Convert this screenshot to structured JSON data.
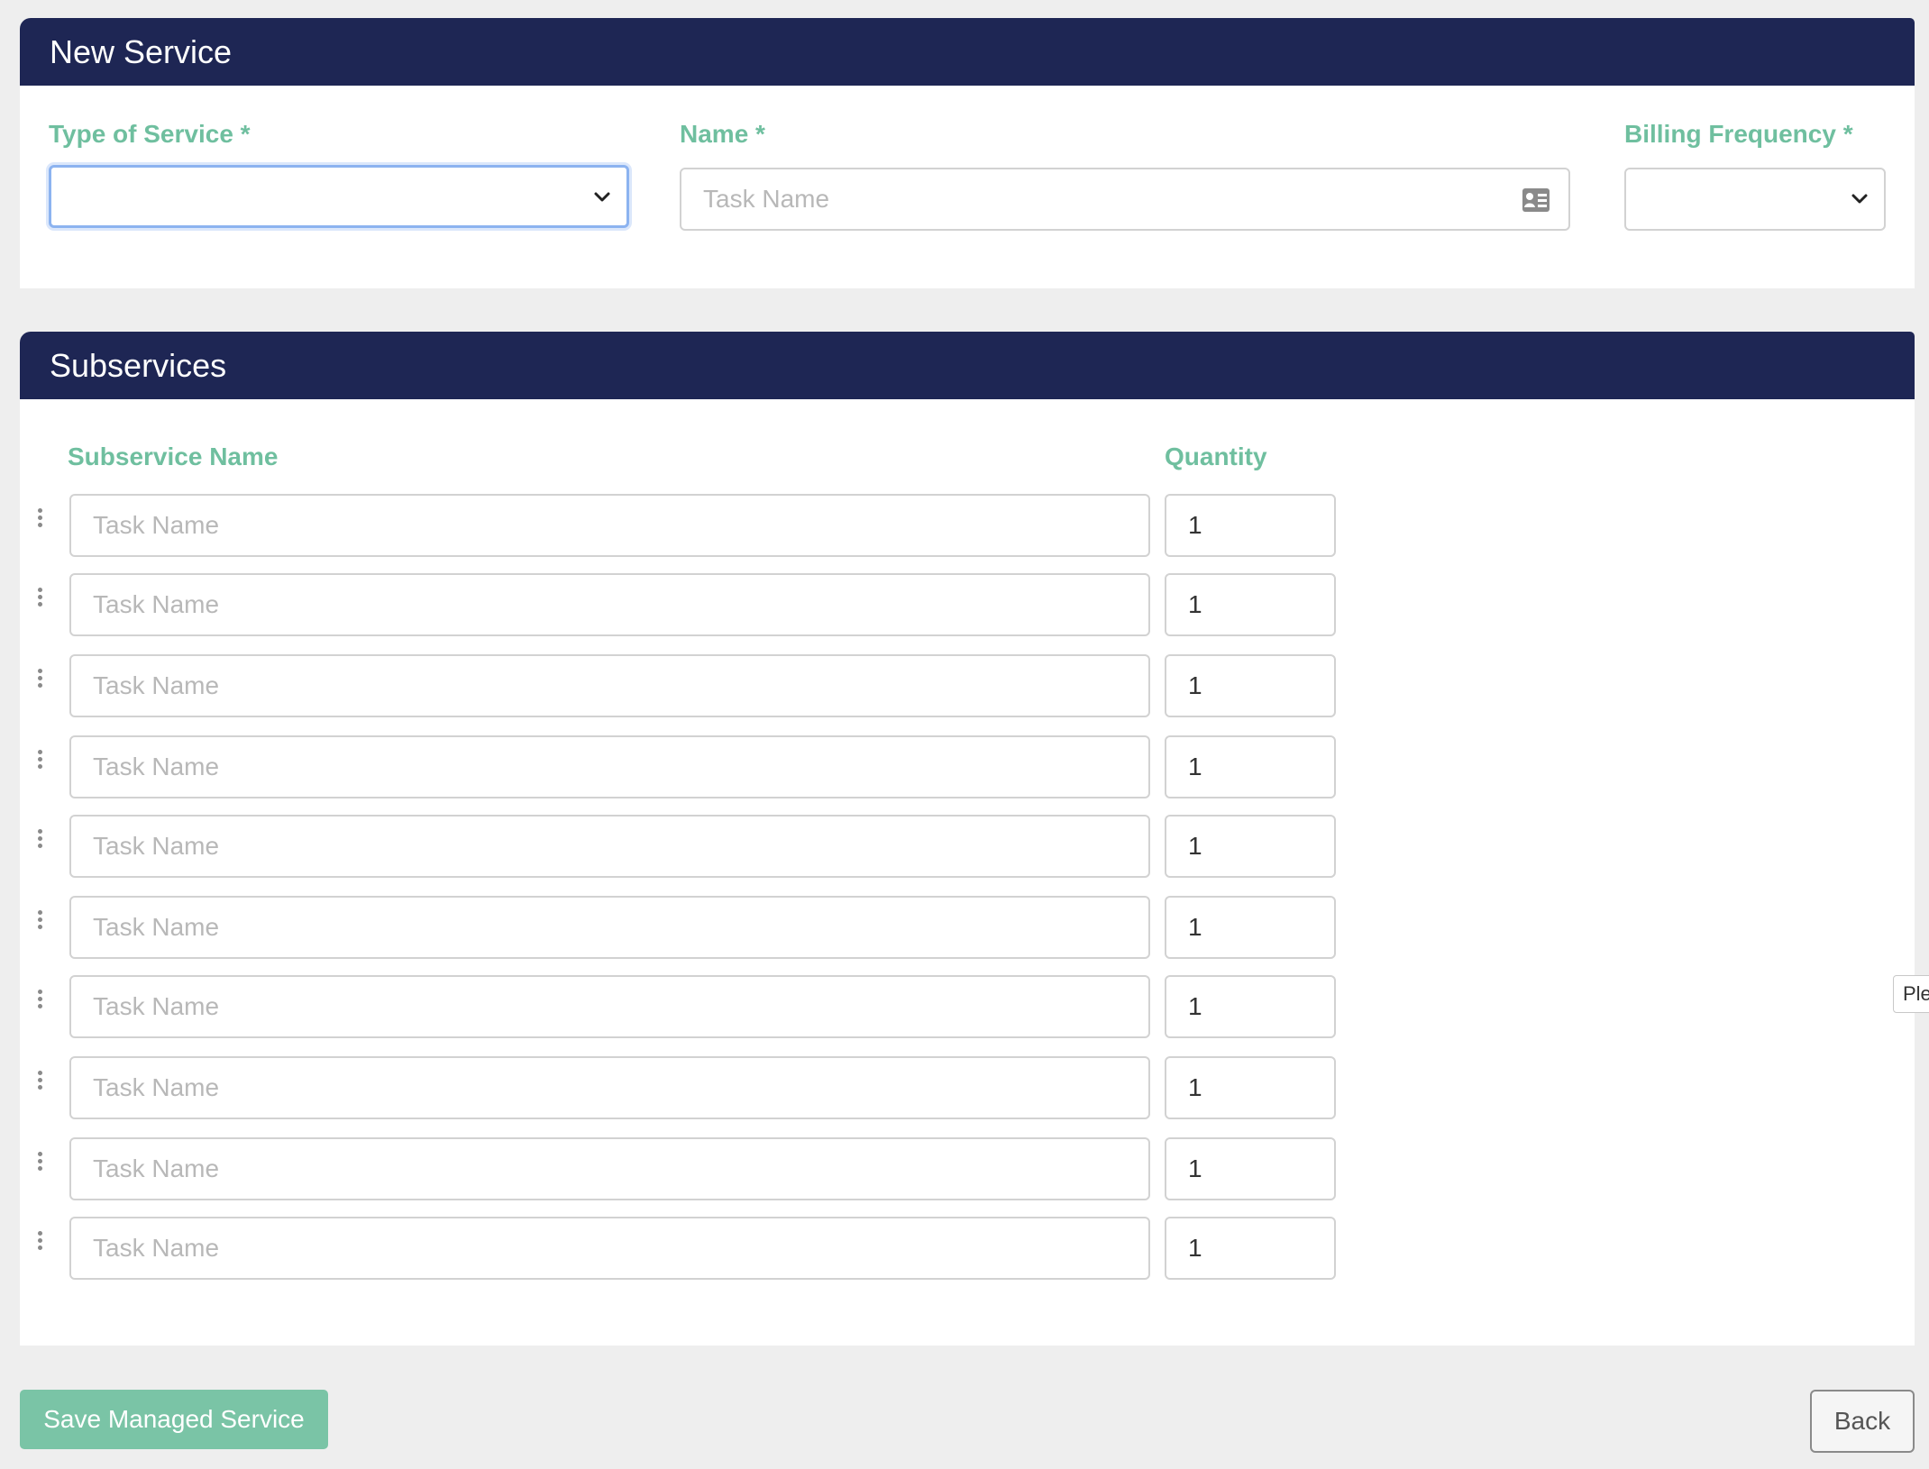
{
  "new_service": {
    "title": "New Service",
    "type_of_service": {
      "label": "Type of Service *",
      "value": ""
    },
    "name": {
      "label": "Name *",
      "placeholder": "Task Name"
    },
    "billing_frequency": {
      "label": "Billing Frequency *",
      "value": ""
    }
  },
  "subservices": {
    "title": "Subservices",
    "col_name": "Subservice Name",
    "col_quantity": "Quantity",
    "rows": [
      {
        "placeholder": "Task Name",
        "quantity": "1"
      },
      {
        "placeholder": "Task Name",
        "quantity": "1"
      },
      {
        "placeholder": "Task Name",
        "quantity": "1"
      },
      {
        "placeholder": "Task Name",
        "quantity": "1"
      },
      {
        "placeholder": "Task Name",
        "quantity": "1"
      },
      {
        "placeholder": "Task Name",
        "quantity": "1"
      },
      {
        "placeholder": "Task Name",
        "quantity": "1"
      },
      {
        "placeholder": "Task Name",
        "quantity": "1"
      },
      {
        "placeholder": "Task Name",
        "quantity": "1"
      },
      {
        "placeholder": "Task Name",
        "quantity": "1"
      }
    ]
  },
  "actions": {
    "save_label": "Save Managed Service",
    "back_label": "Back"
  },
  "tooltip_peek": "Ple",
  "colors": {
    "header_bg": "#1e2654",
    "label_green": "#6fbf9f",
    "save_btn": "#7ac4a6"
  }
}
